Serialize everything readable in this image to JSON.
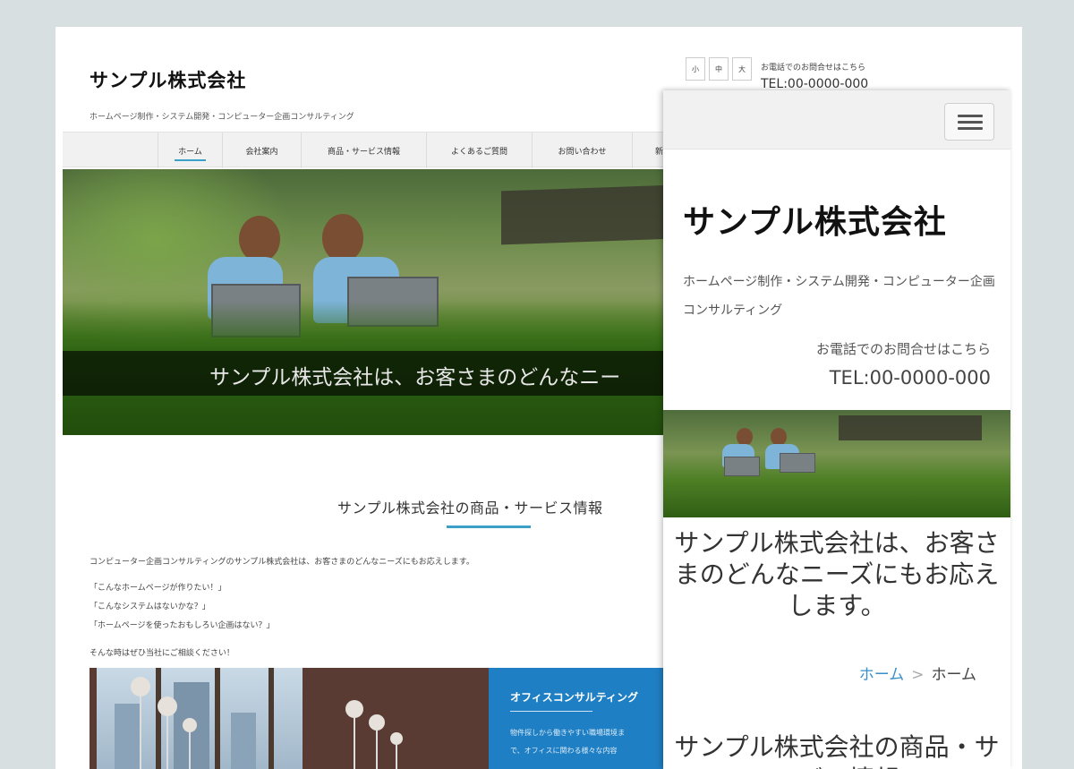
{
  "desktop": {
    "site_title": "サンプル株式会社",
    "site_description": "ホームページ制作・システム開発・コンピューター企画コンサルティング",
    "font_size_buttons": [
      "小",
      "中",
      "大"
    ],
    "tel_label": "お電話でのお問合せはこちら",
    "tel_number": "TEL:00-0000-000",
    "nav": [
      {
        "label": "ホーム",
        "active": true
      },
      {
        "label": "会社案内"
      },
      {
        "label": "商品・サービス情報"
      },
      {
        "label": "よくあるご質問"
      },
      {
        "label": "お問い合わせ"
      },
      {
        "label": "新"
      }
    ],
    "hero_caption": "サンプル株式会社は、お客さまのどんなニー",
    "section_title": "サンプル株式会社の商品・サービス情報",
    "intro": "コンピューター企画コンサルティングのサンプル株式会社は、お客さまのどんなニーズにもお応えします。",
    "quotes": [
      "「こんなホームページが作りたい！」",
      "「こんなシステムはないかな？」",
      "「ホームページを使ったおもしろい企画はない？」"
    ],
    "closing": "そんな時はぜひ当社にご相談ください！",
    "promo": {
      "title": "オフィスコンサルティング",
      "lines": [
        "物件探しから働きやすい職場環境ま",
        "で、オフィスに関わる様々な内容"
      ]
    }
  },
  "mobile": {
    "site_title": "サンプル株式会社",
    "site_description": "ホームページ制作・システム開発・コンピューター企画コンサルティング",
    "tel_label": "お電話でのお問合せはこちら",
    "tel_number": "TEL:00-0000-000",
    "hero_caption": "サンプル株式会社は、お客さまのどんなニーズにもお応えします。",
    "breadcrumb": [
      "ホーム",
      "ホーム"
    ],
    "breadcrumb_sep": ">",
    "section_title": "サンプル株式会社の商品・サービス情報"
  },
  "colors": {
    "accent": "#3aa0c8",
    "promo_blue": "#1f7fc4",
    "background": "#d8dfe0"
  },
  "icons": {
    "menu": "hamburger-icon"
  }
}
